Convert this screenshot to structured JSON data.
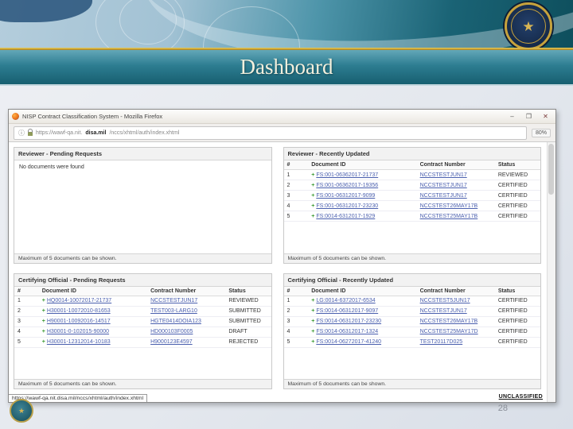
{
  "slide": {
    "title": "Dashboard",
    "page_number": "28"
  },
  "browser": {
    "window_title": "NISP Contract Classification System - Mozilla Firefox",
    "window_controls": {
      "minimize": "–",
      "maximize": "❐",
      "close": "✕"
    },
    "address": {
      "url_prefix": "https://wawf-qa.nit.",
      "url_domain": "disa.mil",
      "url_suffix": "/nccs/xhtml/auth/index.xhtml",
      "zoom": "80%"
    },
    "status": {
      "link_preview": "https://wawf-qa.nit.disa.mil/nccs/xhtml/auth/index.xhtml",
      "classification": "UNCLASSIFIED"
    }
  },
  "panels": {
    "reviewer_pending": {
      "title": "Reviewer - Pending Requests",
      "empty_message": "No documents were found",
      "footer": "Maximum of 5 documents can be shown."
    },
    "reviewer_recent": {
      "title": "Reviewer - Recently Updated",
      "columns": [
        "#",
        "Document ID",
        "Contract Number",
        "Status"
      ],
      "rows": [
        {
          "num": "1",
          "id": "FS:001-06362017-21737",
          "contract": "NCCSTESTJUN17",
          "status": "REVIEWED"
        },
        {
          "num": "2",
          "id": "FS:001-06362017-19356",
          "contract": "NCCSTESTJUN17",
          "status": "CERTIFIED"
        },
        {
          "num": "3",
          "id": "FS:001-06312017-9099",
          "contract": "NCCSTESTJUN17",
          "status": "CERTIFIED"
        },
        {
          "num": "4",
          "id": "FS:001-06312017-23230",
          "contract": "NCCSTEST26MAY17B",
          "status": "CERTIFIED"
        },
        {
          "num": "5",
          "id": "FS:0014-6312017-1929",
          "contract": "NCCSTEST25MAY17B",
          "status": "CERTIFIED"
        }
      ],
      "footer": "Maximum of 5 documents can be shown."
    },
    "co_pending": {
      "title": "Certifying Official - Pending Requests",
      "columns": [
        "#",
        "Document ID",
        "Contract Number",
        "Status"
      ],
      "rows": [
        {
          "num": "1",
          "id": "HQ0014-10072017-21737",
          "contract": "NCCSTESTJUN17",
          "status": "REVIEWED"
        },
        {
          "num": "2",
          "id": "H30001-10072010-81653",
          "contract": "TEST003-LARG10",
          "status": "SUBMITTED"
        },
        {
          "num": "3",
          "id": "H90001-10092016-14517",
          "contract": "HGTE0414DOIA123",
          "status": "SUBMITTED"
        },
        {
          "num": "4",
          "id": "H30001-0-102015-90000",
          "contract": "HD000103F0005",
          "status": "DRAFT"
        },
        {
          "num": "5",
          "id": "H30001-12312014-10183",
          "contract": "H9000123E4597",
          "status": "REJECTED"
        }
      ],
      "footer": "Maximum of 5 documents can be shown."
    },
    "co_recent": {
      "title": "Certifying Official - Recently Updated",
      "columns": [
        "#",
        "Document ID",
        "Contract Number",
        "Status"
      ],
      "rows": [
        {
          "num": "1",
          "id": "LG:0014-6372017-6534",
          "contract": "NCCSTEST5JUN17",
          "status": "CERTIFIED"
        },
        {
          "num": "2",
          "id": "FS:0014-06312017-9097",
          "contract": "NCCSTESTJUN17",
          "status": "CERTIFIED"
        },
        {
          "num": "3",
          "id": "FS:0014-06312017-23230",
          "contract": "NCCSTEST26MAY17B",
          "status": "CERTIFIED"
        },
        {
          "num": "4",
          "id": "FS:0014-06312017-1324",
          "contract": "NCCSTEST25MAY17D",
          "status": "CERTIFIED"
        },
        {
          "num": "5",
          "id": "FS:0014-06272017-41240",
          "contract": "TEST20117D025",
          "status": "CERTIFIED"
        }
      ],
      "footer": "Maximum of 5 documents can be shown."
    }
  }
}
